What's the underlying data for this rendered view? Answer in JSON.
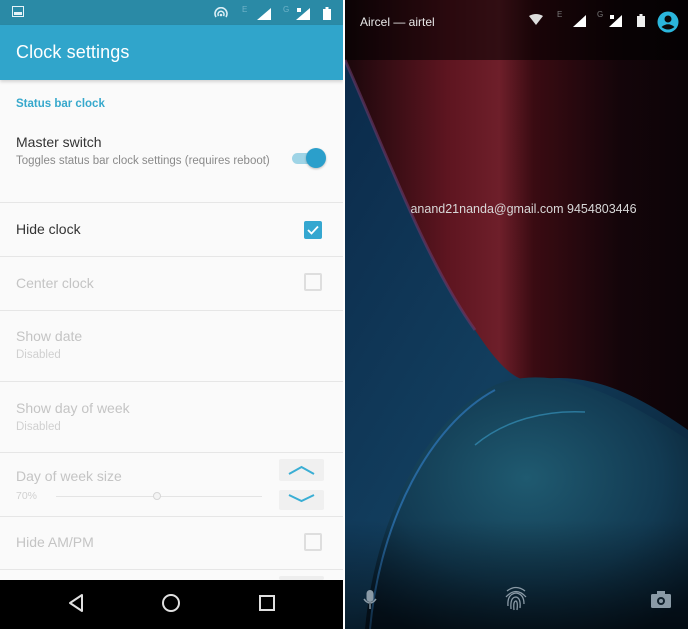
{
  "left_screen": {
    "status_bar": {
      "icons": [
        "image-notification-icon",
        "hotspot-icon",
        "network-type-e-icon",
        "signal-icon",
        "network-type-g-icon",
        "signal-no-data-icon",
        "battery-icon"
      ],
      "network_labels": {
        "sim1": "E",
        "sim2": "G"
      }
    },
    "app_bar": {
      "title": "Clock settings"
    },
    "section": {
      "header": "Status bar clock"
    },
    "settings": [
      {
        "title": "Master switch",
        "subtitle": "Toggles status bar clock settings (requires reboot)",
        "control": "toggle",
        "value": true,
        "enabled": true
      },
      {
        "title": "Hide clock",
        "control": "checkbox",
        "value": true,
        "enabled": true
      },
      {
        "title": "Center clock",
        "control": "checkbox",
        "value": false,
        "enabled": false
      },
      {
        "title": "Show date",
        "subtitle": "Disabled",
        "enabled": false
      },
      {
        "title": "Show day of week",
        "subtitle": "Disabled",
        "enabled": false
      },
      {
        "title": "Day of week size",
        "value_label": "70%",
        "control": "slider",
        "slider_fraction": 0.49,
        "enabled": false
      },
      {
        "title": "Hide AM/PM",
        "control": "checkbox",
        "value": false,
        "enabled": false
      }
    ],
    "navigation": {
      "back": "back-icon",
      "home": "home-icon",
      "recents": "recents-icon"
    }
  },
  "right_screen": {
    "status_bar": {
      "carrier": "Aircel — airtel",
      "network_labels": {
        "sim1": "E",
        "sim2": "G"
      },
      "icons": [
        "wifi-icon",
        "signal-icon",
        "signal-no-data-icon",
        "battery-icon",
        "user-account-icon"
      ]
    },
    "owner_info": "anand21nanda@gmail.com 9454803446",
    "bottom_shortcuts": [
      "microphone-icon",
      "fingerprint-icon",
      "camera-icon"
    ],
    "colors": {
      "accent": "#2bb6dc",
      "wallpaper_red": "#6e1a24",
      "wallpaper_blue": "#1a4a6e"
    }
  },
  "theme": {
    "primary": "#30a5cb",
    "primary_dark": "#2a8aa6",
    "accent": "#35a7d0"
  }
}
